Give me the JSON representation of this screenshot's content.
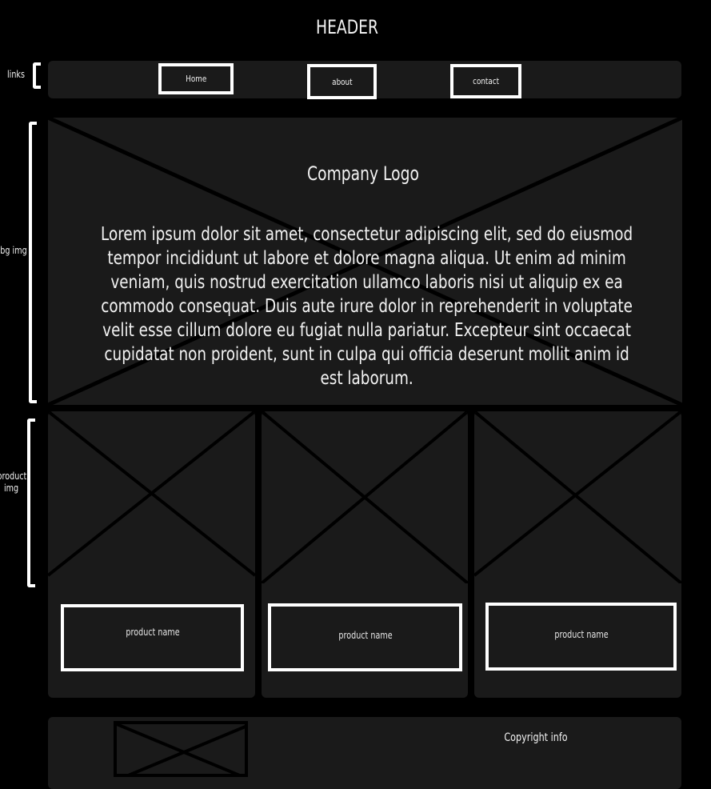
{
  "header": {
    "title": "HEADER"
  },
  "annotations": {
    "links": "links",
    "bg_img": "bg img",
    "product_img": "product img"
  },
  "nav": {
    "links": [
      {
        "label": "Home"
      },
      {
        "label": "about"
      },
      {
        "label": "contact"
      }
    ]
  },
  "hero": {
    "logo": "Company Logo",
    "text": "Lorem ipsum dolor sit amet, consectetur adipiscing elit, sed do eiusmod tempor incididunt ut labore et dolore magna aliqua. Ut enim ad minim veniam, quis nostrud exercitation ullamco laboris nisi ut aliquip ex ea commodo consequat. Duis aute irure dolor in reprehenderit in voluptate velit esse cillum dolore eu fugiat nulla pariatur. Excepteur sint occaecat cupidatat non proident, sunt in culpa qui officia deserunt mollit anim id est laborum."
  },
  "products": [
    {
      "name": "product name"
    },
    {
      "name": "product name"
    },
    {
      "name": "product name"
    }
  ],
  "footer": {
    "copyright": "Copyright info"
  },
  "colors": {
    "background": "#000000",
    "panel": "#1a1a1a",
    "outline": "#ffffff"
  }
}
